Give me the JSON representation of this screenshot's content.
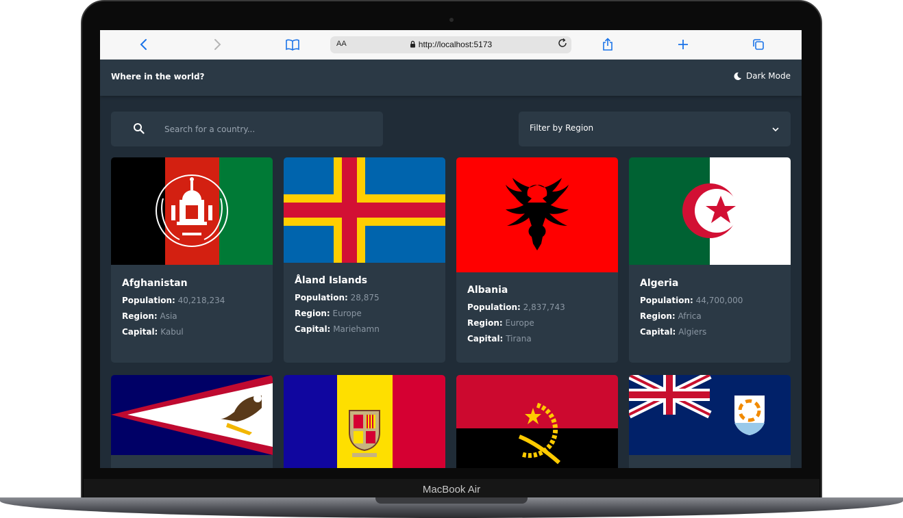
{
  "device": {
    "label": "MacBook Air"
  },
  "browser": {
    "text_size": "AA",
    "url": "http://localhost:5173"
  },
  "header": {
    "title": "Where in the world?",
    "mode_label": "Dark Mode"
  },
  "search": {
    "placeholder": "Search for a country..."
  },
  "filter": {
    "label": "Filter by Region"
  },
  "countries": [
    {
      "name": "Afghanistan",
      "population": "40,218,234",
      "region": "Asia",
      "capital": "Kabul"
    },
    {
      "name": "Åland Islands",
      "population": "28,875",
      "region": "Europe",
      "capital": "Mariehamn"
    },
    {
      "name": "Albania",
      "population": "2,837,743",
      "region": "Europe",
      "capital": "Tirana"
    },
    {
      "name": "Algeria",
      "population": "44,700,000",
      "region": "Africa",
      "capital": "Algiers"
    }
  ],
  "labels": {
    "population": "Population:",
    "region": "Region:",
    "capital": "Capital:"
  },
  "colors": {
    "background": "#202c37",
    "element": "#2b3945",
    "text": "#ffffff",
    "muted": "#8b97a3",
    "browser_accent": "#1a73e8"
  }
}
